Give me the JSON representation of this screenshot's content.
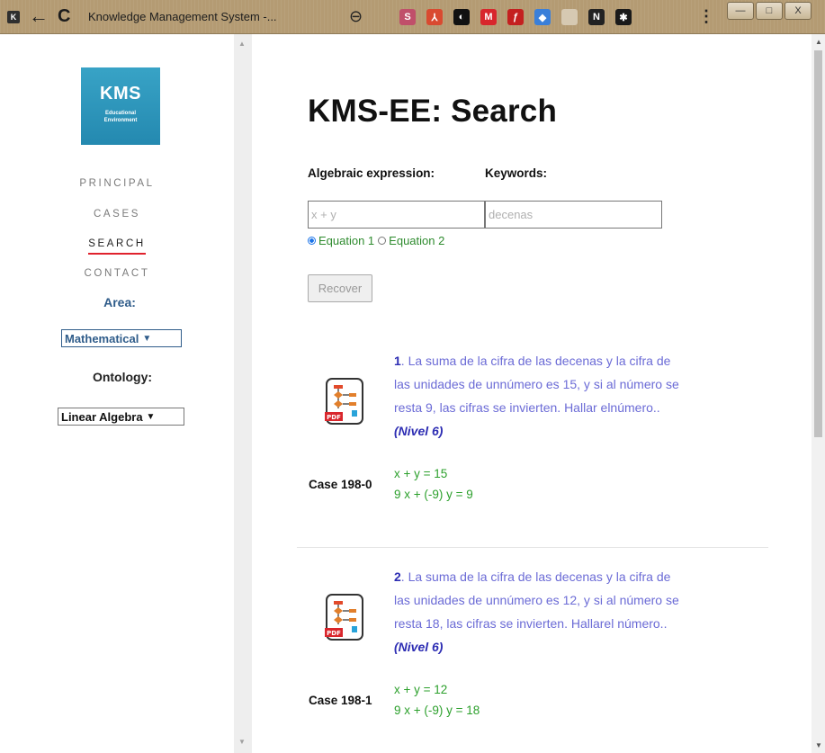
{
  "browser": {
    "favicon_letter": "K",
    "back_glyph": "←",
    "reload_glyph": "C",
    "tab_title": "Knowledge Management System -...",
    "zoom_glyph": "⊖",
    "menu_glyph": "⋮",
    "extensions": [
      {
        "name": "s-extension-icon",
        "label": "S",
        "color": "#c04f6a"
      },
      {
        "name": "pdf-extension-icon",
        "label": "⅄",
        "color": "#d94a30"
      },
      {
        "name": "contrast-extension-icon",
        "label": "◐",
        "color": "#111111"
      },
      {
        "name": "mendeley-extension-icon",
        "label": "M",
        "color": "#d8262c"
      },
      {
        "name": "flash-extension-icon",
        "label": "ƒ",
        "color": "#c42020"
      },
      {
        "name": "diamond-extension-icon",
        "label": "◆",
        "color": "#3a7fd9"
      },
      {
        "name": "blank-extension-icon",
        "label": "",
        "color": "#d6c9b2"
      },
      {
        "name": "notion-extension-icon",
        "label": "N",
        "color": "#222222"
      },
      {
        "name": "puzzle-extension-icon",
        "label": "✱",
        "color": "#1a1a1a"
      }
    ],
    "window_buttons": [
      "—",
      "□",
      "X"
    ]
  },
  "sidebar": {
    "logo": {
      "title": "KMS",
      "line1": "Educational",
      "line2": "Environment"
    },
    "menu": [
      {
        "label": "PRINCIPAL",
        "active": false
      },
      {
        "label": "CASES",
        "active": false
      },
      {
        "label": "SEARCH",
        "active": true
      },
      {
        "label": "CONTACT",
        "active": false
      }
    ],
    "area_label": "Area:",
    "area_value": "Mathematical",
    "ontology_label": "Ontology:",
    "ontology_value": "Linear Algebra",
    "chevron": "⌄"
  },
  "main": {
    "title": "KMS-EE: Search",
    "algebraic_label": "Algebraic expression:",
    "keywords_label": "Keywords:",
    "algebraic_placeholder": "x + y",
    "keywords_placeholder": "decenas",
    "radio1": "Equation 1",
    "radio2": "Equation 2",
    "recover_label": "Recover",
    "results": [
      {
        "number": "1",
        "text": ". La suma de la cifra de las decenas y la cifra de las unidades de unnúmero es 15, y si al número se resta 9, las cifras se invierten. Hallar elnúmero.. ",
        "level": "(Nivel 6)",
        "case": "Case 198-0",
        "eq1": "x + y = 15",
        "eq2": "9 x + (-9) y = 9"
      },
      {
        "number": "2",
        "text": ". La suma de la cifra de las decenas y la cifra de las unidades de unnúmero es 12, y si al número se resta 18, las cifras se invierten. Hallarel número.. ",
        "level": "(Nivel 6)",
        "case": "Case 198-1",
        "eq1": "x + y = 12",
        "eq2": "9 x + (-9) y = 18"
      }
    ]
  },
  "colors": {
    "chrome": "#b49b73",
    "accent_red": "#e0222d",
    "link_blue": "#6b6bd6",
    "eq_green": "#2ca02c",
    "area_blue": "#2f5c8a"
  }
}
